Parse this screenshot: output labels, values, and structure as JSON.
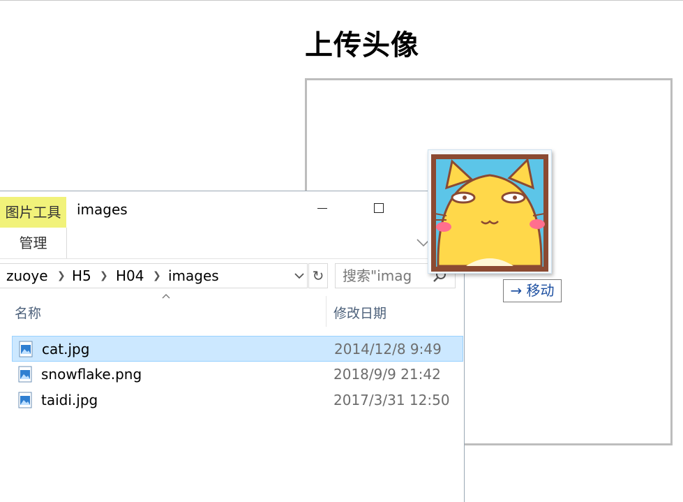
{
  "page": {
    "title": "上传头像",
    "drag_label": "→ 移动"
  },
  "explorer": {
    "ribbon_tool": "图片工具",
    "ribbon_manage": "管理",
    "window_title": "images",
    "close_glyph": "✕",
    "breadcrumb": [
      "zuoye",
      "H5",
      "H04",
      "images"
    ],
    "search_placeholder": "搜索\"imag",
    "columns": {
      "name": "名称",
      "modified": "修改日期"
    },
    "files": [
      {
        "name": "cat.jpg",
        "modified": "2014/12/8 9:49",
        "selected": true
      },
      {
        "name": "snowflake.png",
        "modified": "2018/9/9 21:42",
        "selected": false
      },
      {
        "name": "taidi.jpg",
        "modified": "2017/3/31 12:50",
        "selected": false
      }
    ]
  },
  "colors": {
    "ribbon_tool_bg": "#f1f27a",
    "selection_bg": "#cce8ff",
    "move_label_text": "#1b4ea0"
  }
}
